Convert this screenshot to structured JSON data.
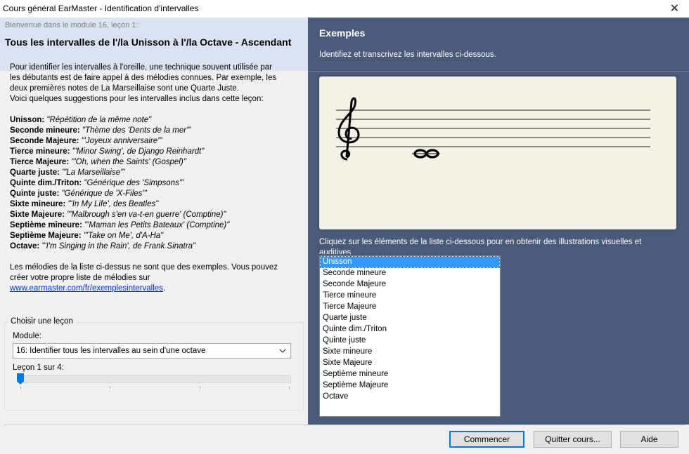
{
  "window": {
    "title": "Cours général EarMaster - Identification d'intervalles",
    "close_glyph": "✕"
  },
  "left": {
    "welcome": "Bienvenue dans le module 16, leçon 1:",
    "heading": "Tous les intervalles de l'/la Unisson à l'/la Octave - Ascendant",
    "intro": [
      "Pour identifier les intervalles à l'oreille, une technique souvent utilisée par",
      "les débutants est de faire appel à des mélodies connues. Par exemple, les",
      "deux premières notes de La Marseillaise sont une Quarte Juste.",
      "Voici quelques suggestions pour les intervalles inclus dans cette leçon:"
    ],
    "examples": [
      {
        "name": "Unisson:",
        "desc": " \"Répétition de la même note\""
      },
      {
        "name": "Seconde mineure:",
        "desc": " \"Thème des 'Dents de la mer'\""
      },
      {
        "name": "Seconde Majeure:",
        "desc": " \"'Joyeux anniversaire'\""
      },
      {
        "name": "Tierce mineure:",
        "desc": " \"'Minor Swing', de Django Reinhardt\""
      },
      {
        "name": "Tierce Majeure:",
        "desc": " \"'Oh, when the Saints' (Gospel)\""
      },
      {
        "name": "Quarte juste:",
        "desc": " \"'La Marseillaise'\""
      },
      {
        "name": "Quinte dim./Triton:",
        "desc": " \"Générique des 'Simpsons'\""
      },
      {
        "name": "Quinte juste:",
        "desc": " \"Générique de 'X-Files'\""
      },
      {
        "name": "Sixte mineure:",
        "desc": " \"'In My Life', des Beatles\""
      },
      {
        "name": "Sixte Majeure:",
        "desc": " \"'Malbrough s'en va-t-en guerre' (Comptine)\""
      },
      {
        "name": "Septième mineure:",
        "desc": " \"'Maman les Petits Bateaux' (Comptine)\""
      },
      {
        "name": "Septième Majeure:",
        "desc": " \"'Take on Me', d'A-Ha\""
      },
      {
        "name": "Octave:",
        "desc": " \"'I'm Singing in the Rain', de Frank Sinatra\""
      }
    ],
    "outro": [
      "Les mélodies de la liste ci-dessus ne sont que des exemples. Vous pouvez",
      "créer votre propre liste de mélodies sur"
    ],
    "link": "www.earmaster.com/fr/exemplesintervalles",
    "link_suffix": ".",
    "choose_lesson": "Choisir une leçon",
    "module_label": "Module:",
    "module_value": "16: Identifier tous les intervalles au sein d'une octave",
    "lesson_label": "Leçon 1 sur 4:",
    "lesson_slider": {
      "current": 1,
      "total": 4
    }
  },
  "right": {
    "heading": "Exemples",
    "subtitle": "Identifiez et transcrivez les intervalles ci-dessous.",
    "instruction": "Cliquez sur les éléments de la liste ci-dessous pour en obtenir des illustrations visuelles et auditives",
    "list": [
      "Unisson",
      "Seconde mineure",
      "Seconde Majeure",
      "Tierce mineure",
      "Tierce Majeure",
      "Quarte juste",
      "Quinte dim./Triton",
      "Quinte juste",
      "Sixte mineure",
      "Sixte Majeure",
      "Septième mineure",
      "Septième Majeure",
      "Octave"
    ],
    "selected_index": 0
  },
  "buttons": {
    "start": "Commencer",
    "quit": "Quitter cours...",
    "help": "Aide"
  },
  "colors": {
    "left_header": "#dbe3f3",
    "right_bg": "#4a5a78",
    "selection": "#3399ff",
    "link": "#0033cc",
    "slider": "#0078d7"
  }
}
